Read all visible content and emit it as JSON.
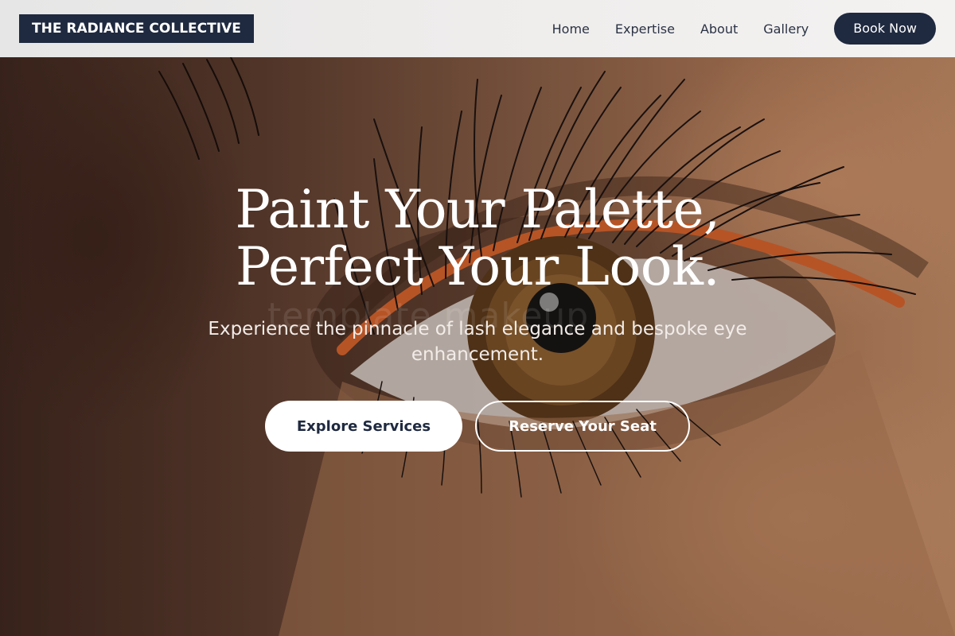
{
  "header": {
    "logo_text": "THE RADIANCE COLLECTIVE",
    "nav": [
      {
        "label": "Home"
      },
      {
        "label": "Expertise"
      },
      {
        "label": "About"
      },
      {
        "label": "Gallery"
      }
    ],
    "cta_label": "Book Now"
  },
  "hero": {
    "title": "Paint Your Palette, Perfect Your Look.",
    "subtitle": "Experience the pinnacle of lash elegance and bespoke eye enhancement.",
    "watermark": "template makeup",
    "primary_button": "Explore Services",
    "secondary_button": "Reserve Your Seat"
  },
  "colors": {
    "brand_navy": "#1f2a40",
    "header_bg": "#efedec",
    "text_white": "#ffffff"
  }
}
